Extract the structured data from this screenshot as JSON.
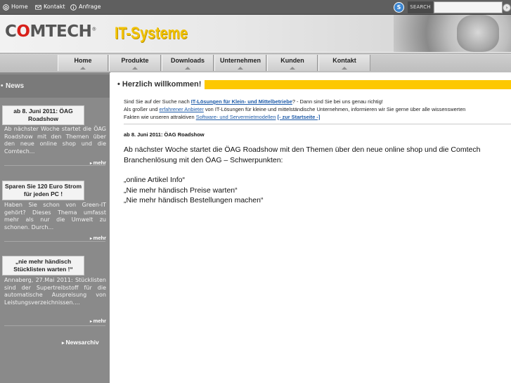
{
  "topbar": {
    "links": [
      {
        "label": "Home",
        "icon": "home-icon"
      },
      {
        "label": "Kontakt",
        "icon": "mail-icon"
      },
      {
        "label": "Anfrage",
        "icon": "info-icon"
      }
    ],
    "search_label": "SEARCH",
    "search_value": "",
    "skype_icon": "skype-icon",
    "go_symbol": "›"
  },
  "header": {
    "logo_left": "C",
    "logo_o": "O",
    "logo_rest": "MTECH",
    "logo_reg": "®",
    "tagline": "IT-Systeme"
  },
  "nav": {
    "items": [
      "Home",
      "Produkte",
      "Downloads",
      "Unternehmen",
      "Kunden",
      "Kontakt"
    ]
  },
  "sidebar": {
    "title": "News",
    "news": [
      {
        "title": "ab 8. Juni 2011: ÖAG Roadshow",
        "text": "Ab nächster Woche startet die ÖAG Roadshow mit den Themen über den neue online shop und die Comtech...",
        "more": "mehr"
      },
      {
        "title": "Sparen Sie 120 Euro Strom für jeden PC !",
        "text": "Haben Sie schon von Green-IT gehört? Dieses Thema umfasst mehr als nur die Umwelt zu schonen. Durch...",
        "more": "mehr"
      },
      {
        "title": "„nie mehr händisch Stücklisten warten !“",
        "text": "Annaberg, 27.Mai 2011: Stücklisten sind der Supertreibstoff für die automatische Auspreisung von Leistungsverzeichnissen....",
        "more": "mehr"
      }
    ],
    "archive": "Newsarchiv"
  },
  "main": {
    "welcome": "Herzlich willkommen!",
    "intro": {
      "p1_a": "Sind Sie auf der Suche nach ",
      "p1_link": "IT-Lösungen für Klein- und Mittelbetriebe",
      "p1_b": "? - Dann sind Sie bei uns genau richtig!",
      "p2_a": "Als großer und ",
      "p2_link": "erfahrener Anbieter",
      "p2_b": " von IT-Lösungen für kleine und mittelständische Unternehmen, informieren wir Sie gerne über alle wissenswerten",
      "p3_a": "Fakten wie unseren attraktiven ",
      "p3_link": "Software- und Servermietmodellen",
      "p3_sep": " ",
      "p3_link2": "[- zur Startseite -]"
    },
    "article": {
      "title": "ab 8. Juni 2011: ÖAG Roadshow",
      "body": "Ab nächster Woche startet die ÖAG Roadshow mit den Themen über den neue online shop und die Comtech Branchenlösung mit den ÖAG – Schwerpunkten:",
      "items": [
        "„online Artikel Info“",
        "„Nie mehr händisch Preise warten“",
        "„Nie mehr händisch Bestellungen machen“"
      ]
    }
  }
}
